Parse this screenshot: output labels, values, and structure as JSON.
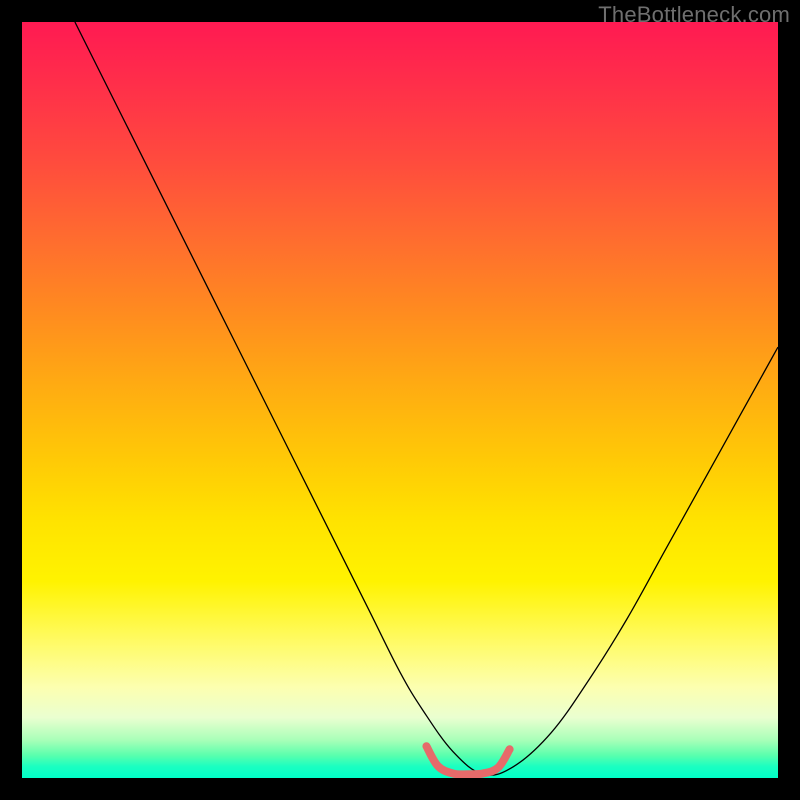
{
  "watermark": "TheBottleneck.com",
  "chart_data": {
    "type": "line",
    "title": "",
    "xlabel": "",
    "ylabel": "",
    "xlim": [
      0,
      100
    ],
    "ylim": [
      0,
      100
    ],
    "grid": false,
    "legend": false,
    "annotations": [],
    "series": [
      {
        "name": "bottleneck-curve",
        "color": "#000000",
        "stroke_width": 1.3,
        "x": [
          7,
          10,
          14,
          18,
          22,
          26,
          30,
          34,
          38,
          42,
          46,
          50,
          53,
          57,
          61,
          65,
          70,
          75,
          80,
          85,
          90,
          95,
          100
        ],
        "y": [
          100,
          94,
          86,
          78,
          70,
          62,
          54,
          46,
          38,
          30,
          22,
          14,
          9,
          3.5,
          0.5,
          1.5,
          6,
          13,
          21,
          30,
          39,
          48,
          57
        ]
      },
      {
        "name": "optimal-zone",
        "color": "#e66a6a",
        "stroke_width": 8,
        "linecap": "round",
        "x": [
          53.5,
          55,
          57,
          59,
          61,
          63,
          64.5
        ],
        "y": [
          4.2,
          1.6,
          0.6,
          0.5,
          0.6,
          1.4,
          3.8
        ]
      }
    ]
  }
}
